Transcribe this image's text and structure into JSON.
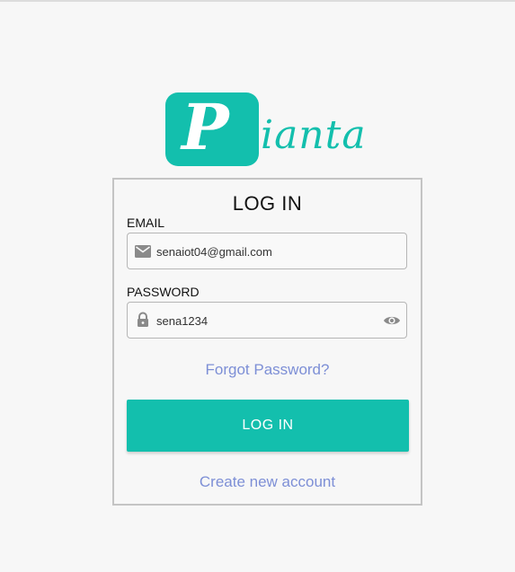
{
  "logo": {
    "letter": "P",
    "rest": "ianta",
    "color": "#13bfad"
  },
  "login": {
    "title": "LOG IN",
    "email_label": "EMAIL",
    "email_value": "senaiot04@gmail.com",
    "password_label": "PASSWORD",
    "password_value": "sena1234",
    "forgot_link": "Forgot Password?",
    "login_button": "LOG IN",
    "create_link": "Create new account"
  },
  "icons": {
    "email": "mail-icon",
    "password": "lock-icon",
    "visibility": "eye-icon"
  },
  "colors": {
    "accent": "#13bfad",
    "link": "#7d8fd6",
    "background": "#f7f7f7"
  }
}
